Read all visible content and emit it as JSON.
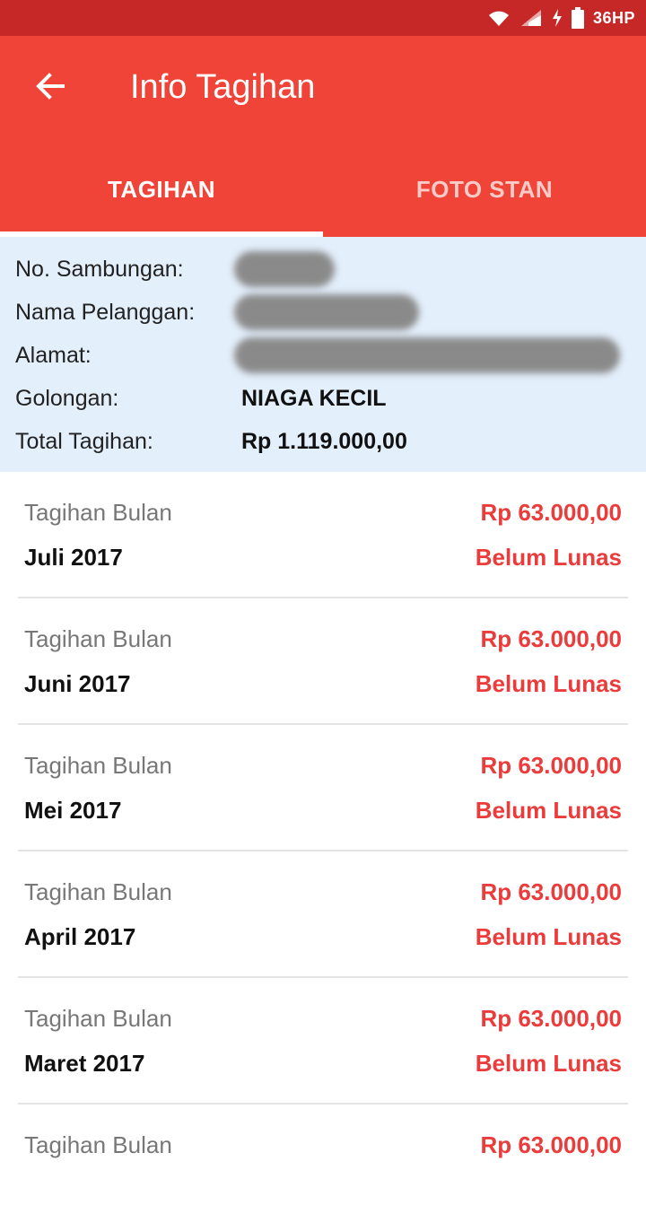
{
  "status_bar": {
    "network_text": "36HP",
    "icons": [
      "wifi-icon",
      "signal-icon",
      "charging-icon",
      "battery-icon"
    ]
  },
  "app_bar": {
    "title": "Info Tagihan",
    "back_icon": "arrow-left-icon",
    "color": "#f04438"
  },
  "tabs": [
    {
      "label": "TAGIHAN",
      "active": true
    },
    {
      "label": "FOTO STAN",
      "active": false
    }
  ],
  "info": {
    "no_sambungan_label": "No. Sambungan:",
    "nama_label": "Nama Pelanggan:",
    "alamat_label": "Alamat:",
    "golongan_label": "Golongan:",
    "golongan_value": "NIAGA KECIL",
    "total_label": "Total Tagihan:",
    "total_value": "Rp 1.119.000,00"
  },
  "bills": [
    {
      "label": "Tagihan Bulan",
      "month": "Juli 2017",
      "amount": "Rp 63.000,00",
      "status": "Belum Lunas"
    },
    {
      "label": "Tagihan Bulan",
      "month": "Juni 2017",
      "amount": "Rp 63.000,00",
      "status": "Belum Lunas"
    },
    {
      "label": "Tagihan Bulan",
      "month": "Mei 2017",
      "amount": "Rp 63.000,00",
      "status": "Belum Lunas"
    },
    {
      "label": "Tagihan Bulan",
      "month": "April 2017",
      "amount": "Rp 63.000,00",
      "status": "Belum Lunas"
    },
    {
      "label": "Tagihan Bulan",
      "month": "Maret 2017",
      "amount": "Rp 63.000,00",
      "status": "Belum Lunas"
    },
    {
      "label": "Tagihan Bulan",
      "month": "",
      "amount": "Rp 63.000,00",
      "status": ""
    }
  ],
  "colors": {
    "accent": "#f04438",
    "status_bar": "#c62828",
    "amount_red": "#ec3b3b",
    "info_bg": "#e3effb"
  }
}
